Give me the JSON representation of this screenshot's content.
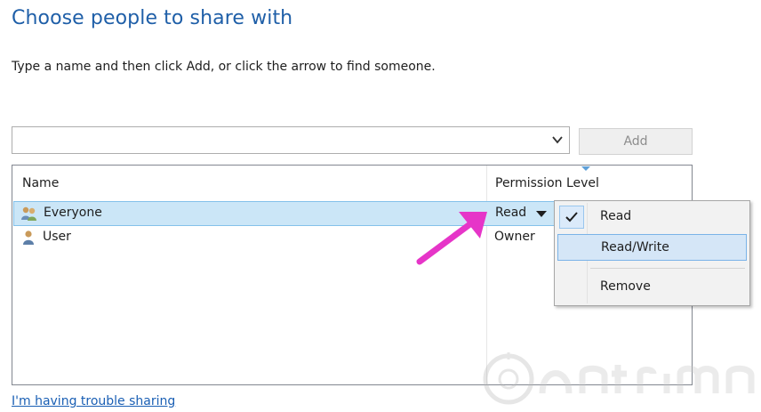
{
  "dialog": {
    "title": "Choose people to share with",
    "instructions": "Type a name and then click Add, or click the arrow to find someone."
  },
  "combo": {
    "value": "",
    "placeholder": ""
  },
  "add_button": {
    "label": "Add",
    "enabled": false
  },
  "table": {
    "columns": [
      "Name",
      "Permission Level"
    ],
    "rows": [
      {
        "name": "Everyone",
        "permission": "Read",
        "icon": "group-icon",
        "selected": true
      },
      {
        "name": "User",
        "permission": "Owner",
        "icon": "user-icon",
        "selected": false
      }
    ]
  },
  "permission_menu": {
    "items": [
      {
        "label": "Read",
        "checked": true
      },
      {
        "label": "Read/Write",
        "highlighted": true
      },
      {
        "label": "Remove"
      }
    ]
  },
  "footer": {
    "link": "I'm having trouble sharing"
  },
  "colors": {
    "title": "#1f5fa8",
    "link": "#1a5fb4",
    "selection": "#cbe6f7",
    "menu_highlight": "#d5e6f7",
    "annotation_arrow": "#e635c8"
  }
}
